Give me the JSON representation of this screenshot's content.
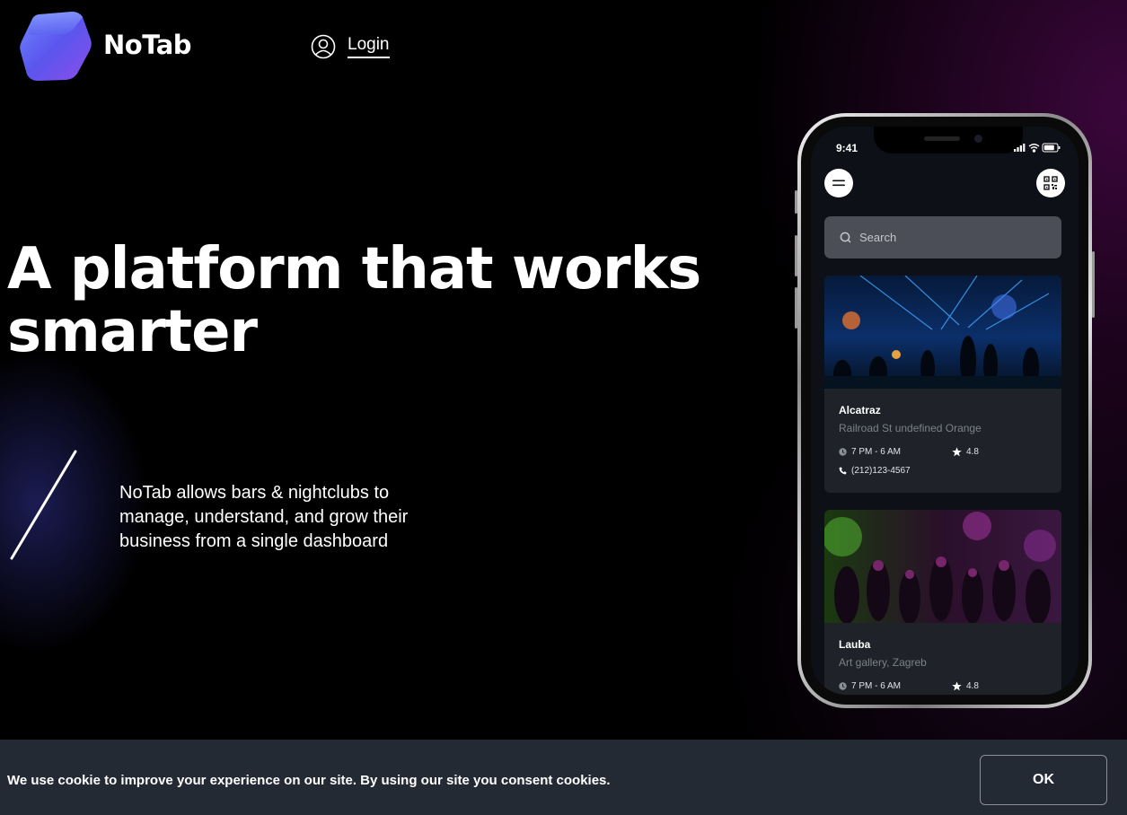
{
  "brand": {
    "name": "NoTab"
  },
  "nav": {
    "login_label": "Login"
  },
  "hero": {
    "title": "A platform that works smarter",
    "description": "NoTab allows bars & nightclubs to manage, understand, and grow their business from a single dashboard"
  },
  "phone": {
    "status_time": "9:41",
    "search_placeholder": "Search",
    "venues": [
      {
        "name": "Alcatraz",
        "address": "Railroad St undefined Orange",
        "hours": "7 PM - 6 AM",
        "rating": "4.8",
        "phone": "(212)123-4567"
      },
      {
        "name": "Lauba",
        "address": "Art gallery, Zagreb",
        "hours": "7 PM - 6 AM",
        "rating": "4.8"
      }
    ]
  },
  "cookie": {
    "message": "We use cookie to improve your experience on our site. By using our site you consent cookies.",
    "ok_label": "OK"
  },
  "colors": {
    "background": "#000000",
    "cookie_bar": "#242a33",
    "logo_accent": "#5a63f0",
    "card_bg": "#1f2228"
  },
  "icons": [
    "logo-cube-icon",
    "user-circle-icon",
    "menu-icon",
    "qr-code-icon",
    "search-icon",
    "clock-icon",
    "star-icon",
    "phone-icon",
    "signal-icon",
    "wifi-icon",
    "battery-icon"
  ]
}
